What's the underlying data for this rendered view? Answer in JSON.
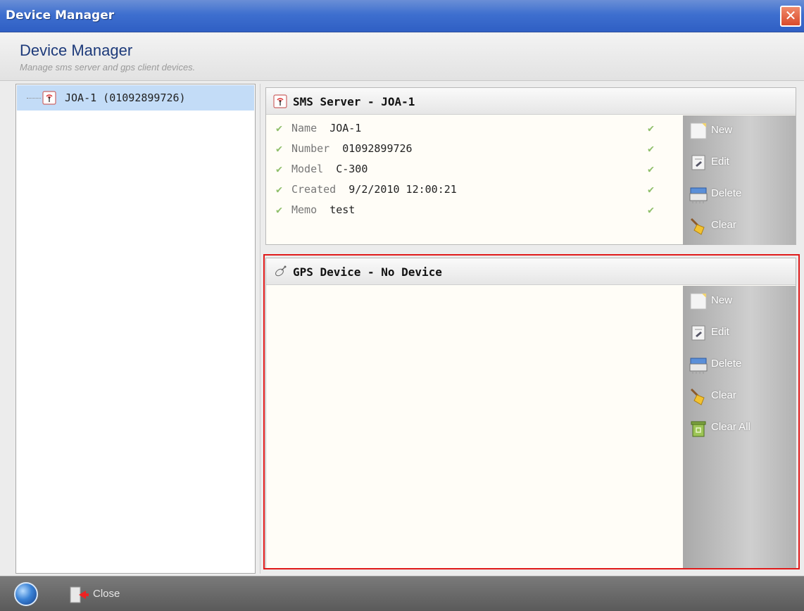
{
  "window": {
    "title": "Device Manager",
    "close_glyph": "✕"
  },
  "header": {
    "title": "Device Manager",
    "subtitle": "Manage sms server and gps client devices."
  },
  "tree": {
    "items": [
      {
        "label": "JOA-1 (01092899726)",
        "icon": "antenna-icon",
        "selected": true
      }
    ]
  },
  "sms_panel": {
    "title": "SMS Server - JOA-1",
    "icon": "antenna-icon",
    "properties": [
      {
        "key": "Name",
        "value": "JOA-1"
      },
      {
        "key": "Number",
        "value": "01092899726"
      },
      {
        "key": "Model",
        "value": "C-300"
      },
      {
        "key": "Created",
        "value": "9/2/2010 12:00:21"
      },
      {
        "key": "Memo",
        "value": "test"
      }
    ],
    "toolbar": [
      "New",
      "Edit",
      "Delete",
      "Clear"
    ]
  },
  "gps_panel": {
    "title": "GPS Device - No Device",
    "icon": "satellite-icon",
    "toolbar": [
      "New",
      "Edit",
      "Delete",
      "Clear",
      "Clear All"
    ]
  },
  "footer": {
    "close_label": "Close"
  },
  "colors": {
    "title_bar": "#3e6fcf",
    "selection": "#c3dcf7",
    "highlight": "#e01a1a",
    "check": "#8fbf6a"
  }
}
